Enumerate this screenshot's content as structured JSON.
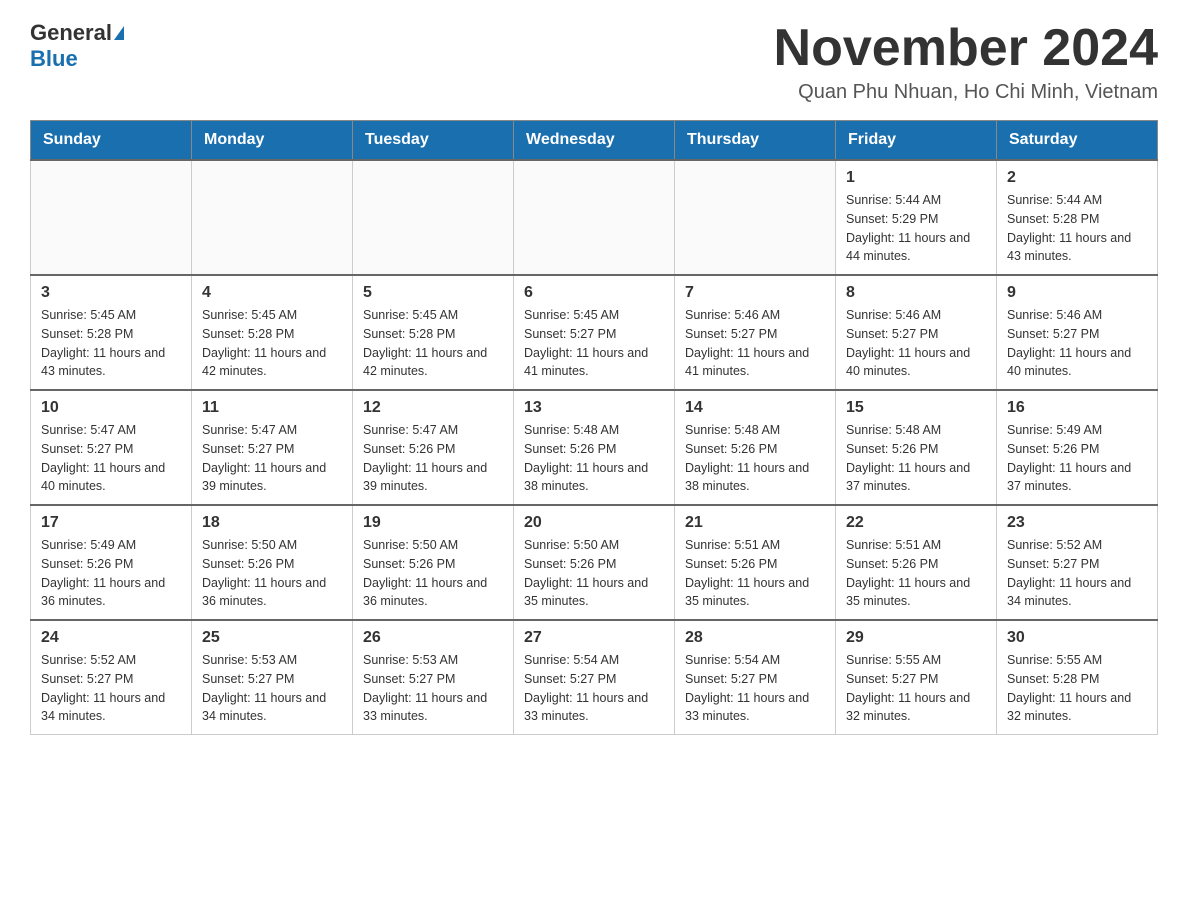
{
  "header": {
    "logo_general": "General",
    "logo_blue": "Blue",
    "month_title": "November 2024",
    "location": "Quan Phu Nhuan, Ho Chi Minh, Vietnam"
  },
  "weekdays": [
    "Sunday",
    "Monday",
    "Tuesday",
    "Wednesday",
    "Thursday",
    "Friday",
    "Saturday"
  ],
  "weeks": [
    [
      {
        "day": "",
        "info": ""
      },
      {
        "day": "",
        "info": ""
      },
      {
        "day": "",
        "info": ""
      },
      {
        "day": "",
        "info": ""
      },
      {
        "day": "",
        "info": ""
      },
      {
        "day": "1",
        "info": "Sunrise: 5:44 AM\nSunset: 5:29 PM\nDaylight: 11 hours and 44 minutes."
      },
      {
        "day": "2",
        "info": "Sunrise: 5:44 AM\nSunset: 5:28 PM\nDaylight: 11 hours and 43 minutes."
      }
    ],
    [
      {
        "day": "3",
        "info": "Sunrise: 5:45 AM\nSunset: 5:28 PM\nDaylight: 11 hours and 43 minutes."
      },
      {
        "day": "4",
        "info": "Sunrise: 5:45 AM\nSunset: 5:28 PM\nDaylight: 11 hours and 42 minutes."
      },
      {
        "day": "5",
        "info": "Sunrise: 5:45 AM\nSunset: 5:28 PM\nDaylight: 11 hours and 42 minutes."
      },
      {
        "day": "6",
        "info": "Sunrise: 5:45 AM\nSunset: 5:27 PM\nDaylight: 11 hours and 41 minutes."
      },
      {
        "day": "7",
        "info": "Sunrise: 5:46 AM\nSunset: 5:27 PM\nDaylight: 11 hours and 41 minutes."
      },
      {
        "day": "8",
        "info": "Sunrise: 5:46 AM\nSunset: 5:27 PM\nDaylight: 11 hours and 40 minutes."
      },
      {
        "day": "9",
        "info": "Sunrise: 5:46 AM\nSunset: 5:27 PM\nDaylight: 11 hours and 40 minutes."
      }
    ],
    [
      {
        "day": "10",
        "info": "Sunrise: 5:47 AM\nSunset: 5:27 PM\nDaylight: 11 hours and 40 minutes."
      },
      {
        "day": "11",
        "info": "Sunrise: 5:47 AM\nSunset: 5:27 PM\nDaylight: 11 hours and 39 minutes."
      },
      {
        "day": "12",
        "info": "Sunrise: 5:47 AM\nSunset: 5:26 PM\nDaylight: 11 hours and 39 minutes."
      },
      {
        "day": "13",
        "info": "Sunrise: 5:48 AM\nSunset: 5:26 PM\nDaylight: 11 hours and 38 minutes."
      },
      {
        "day": "14",
        "info": "Sunrise: 5:48 AM\nSunset: 5:26 PM\nDaylight: 11 hours and 38 minutes."
      },
      {
        "day": "15",
        "info": "Sunrise: 5:48 AM\nSunset: 5:26 PM\nDaylight: 11 hours and 37 minutes."
      },
      {
        "day": "16",
        "info": "Sunrise: 5:49 AM\nSunset: 5:26 PM\nDaylight: 11 hours and 37 minutes."
      }
    ],
    [
      {
        "day": "17",
        "info": "Sunrise: 5:49 AM\nSunset: 5:26 PM\nDaylight: 11 hours and 36 minutes."
      },
      {
        "day": "18",
        "info": "Sunrise: 5:50 AM\nSunset: 5:26 PM\nDaylight: 11 hours and 36 minutes."
      },
      {
        "day": "19",
        "info": "Sunrise: 5:50 AM\nSunset: 5:26 PM\nDaylight: 11 hours and 36 minutes."
      },
      {
        "day": "20",
        "info": "Sunrise: 5:50 AM\nSunset: 5:26 PM\nDaylight: 11 hours and 35 minutes."
      },
      {
        "day": "21",
        "info": "Sunrise: 5:51 AM\nSunset: 5:26 PM\nDaylight: 11 hours and 35 minutes."
      },
      {
        "day": "22",
        "info": "Sunrise: 5:51 AM\nSunset: 5:26 PM\nDaylight: 11 hours and 35 minutes."
      },
      {
        "day": "23",
        "info": "Sunrise: 5:52 AM\nSunset: 5:27 PM\nDaylight: 11 hours and 34 minutes."
      }
    ],
    [
      {
        "day": "24",
        "info": "Sunrise: 5:52 AM\nSunset: 5:27 PM\nDaylight: 11 hours and 34 minutes."
      },
      {
        "day": "25",
        "info": "Sunrise: 5:53 AM\nSunset: 5:27 PM\nDaylight: 11 hours and 34 minutes."
      },
      {
        "day": "26",
        "info": "Sunrise: 5:53 AM\nSunset: 5:27 PM\nDaylight: 11 hours and 33 minutes."
      },
      {
        "day": "27",
        "info": "Sunrise: 5:54 AM\nSunset: 5:27 PM\nDaylight: 11 hours and 33 minutes."
      },
      {
        "day": "28",
        "info": "Sunrise: 5:54 AM\nSunset: 5:27 PM\nDaylight: 11 hours and 33 minutes."
      },
      {
        "day": "29",
        "info": "Sunrise: 5:55 AM\nSunset: 5:27 PM\nDaylight: 11 hours and 32 minutes."
      },
      {
        "day": "30",
        "info": "Sunrise: 5:55 AM\nSunset: 5:28 PM\nDaylight: 11 hours and 32 minutes."
      }
    ]
  ]
}
